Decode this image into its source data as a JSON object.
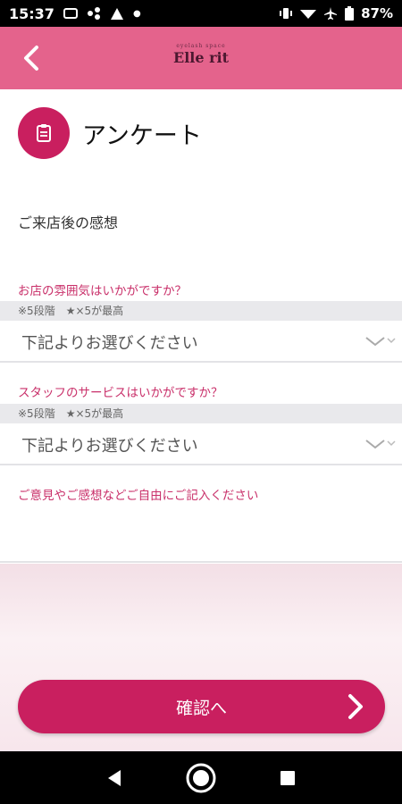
{
  "status_bar": {
    "time": "15:37",
    "battery": "87%"
  },
  "header": {
    "logo_small": "eyelash space",
    "logo_main": "Elle rit"
  },
  "page": {
    "title": "アンケート",
    "section_heading": "ご来店後の感想"
  },
  "questions": [
    {
      "label": "お店の雰囲気はいかがですか？",
      "note": "※5段階　★×5が最高",
      "select_value": "下記よりお選びください"
    },
    {
      "label": "スタッフのサービスはいかがですか？",
      "note": "※5段階　★×5が最高",
      "select_value": "下記よりお選びください"
    }
  ],
  "free_comment": {
    "label": "ご意見やご感想などご自由にご記入ください"
  },
  "confirm_button": {
    "label": "確認へ"
  },
  "colors": {
    "header": "#e4638c",
    "accent": "#c91f5f",
    "label": "#c9306a"
  },
  "icons": [
    "back-icon",
    "document-icon",
    "chevron-down-icon",
    "arrow-right-icon",
    "nav-back-icon",
    "nav-home-icon",
    "nav-recents-icon"
  ]
}
